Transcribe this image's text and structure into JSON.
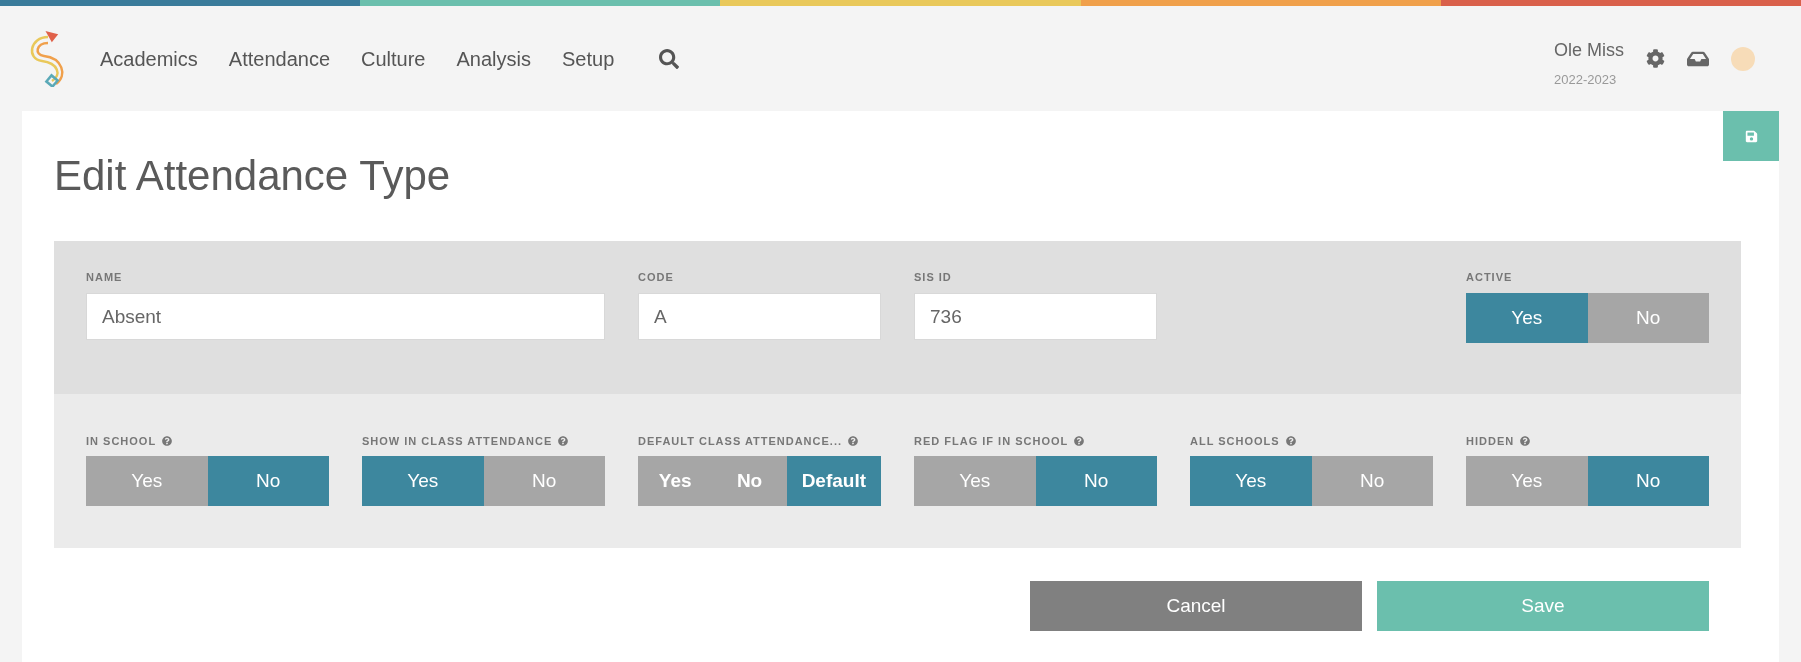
{
  "nav": {
    "items": [
      "Academics",
      "Attendance",
      "Culture",
      "Analysis",
      "Setup"
    ],
    "school": "Ole Miss",
    "year": "2022-2023"
  },
  "title": "Edit Attendance Type",
  "fields": [
    {
      "label": "NAME",
      "value": "Absent",
      "wide": true
    },
    {
      "label": "CODE",
      "value": "A",
      "wide": false
    },
    {
      "label": "SIS ID",
      "value": "736",
      "wide": false
    }
  ],
  "active": {
    "label": "ACTIVE",
    "options": [
      {
        "label": "Yes",
        "selected": true
      },
      {
        "label": "No",
        "selected": false
      }
    ]
  },
  "toggles": [
    {
      "label": "IN SCHOOL",
      "options": [
        {
          "label": "Yes",
          "selected": false
        },
        {
          "label": "No",
          "selected": true
        }
      ]
    },
    {
      "label": "SHOW IN CLASS ATTENDANCE",
      "options": [
        {
          "label": "Yes",
          "selected": true
        },
        {
          "label": "No",
          "selected": false
        }
      ]
    },
    {
      "label": "DEFAULT CLASS ATTENDANCE...",
      "bold": true,
      "options": [
        {
          "label": "Yes",
          "selected": false
        },
        {
          "label": "No",
          "selected": false
        },
        {
          "label": "Default",
          "selected": true
        }
      ]
    },
    {
      "label": "RED FLAG IF IN SCHOOL",
      "options": [
        {
          "label": "Yes",
          "selected": false
        },
        {
          "label": "No",
          "selected": true
        }
      ]
    },
    {
      "label": "ALL SCHOOLS",
      "options": [
        {
          "label": "Yes",
          "selected": true
        },
        {
          "label": "No",
          "selected": false
        }
      ]
    },
    {
      "label": "HIDDEN",
      "options": [
        {
          "label": "Yes",
          "selected": false
        },
        {
          "label": "No",
          "selected": true
        }
      ]
    }
  ],
  "buttons": {
    "cancel": "Cancel",
    "save": "Save"
  }
}
